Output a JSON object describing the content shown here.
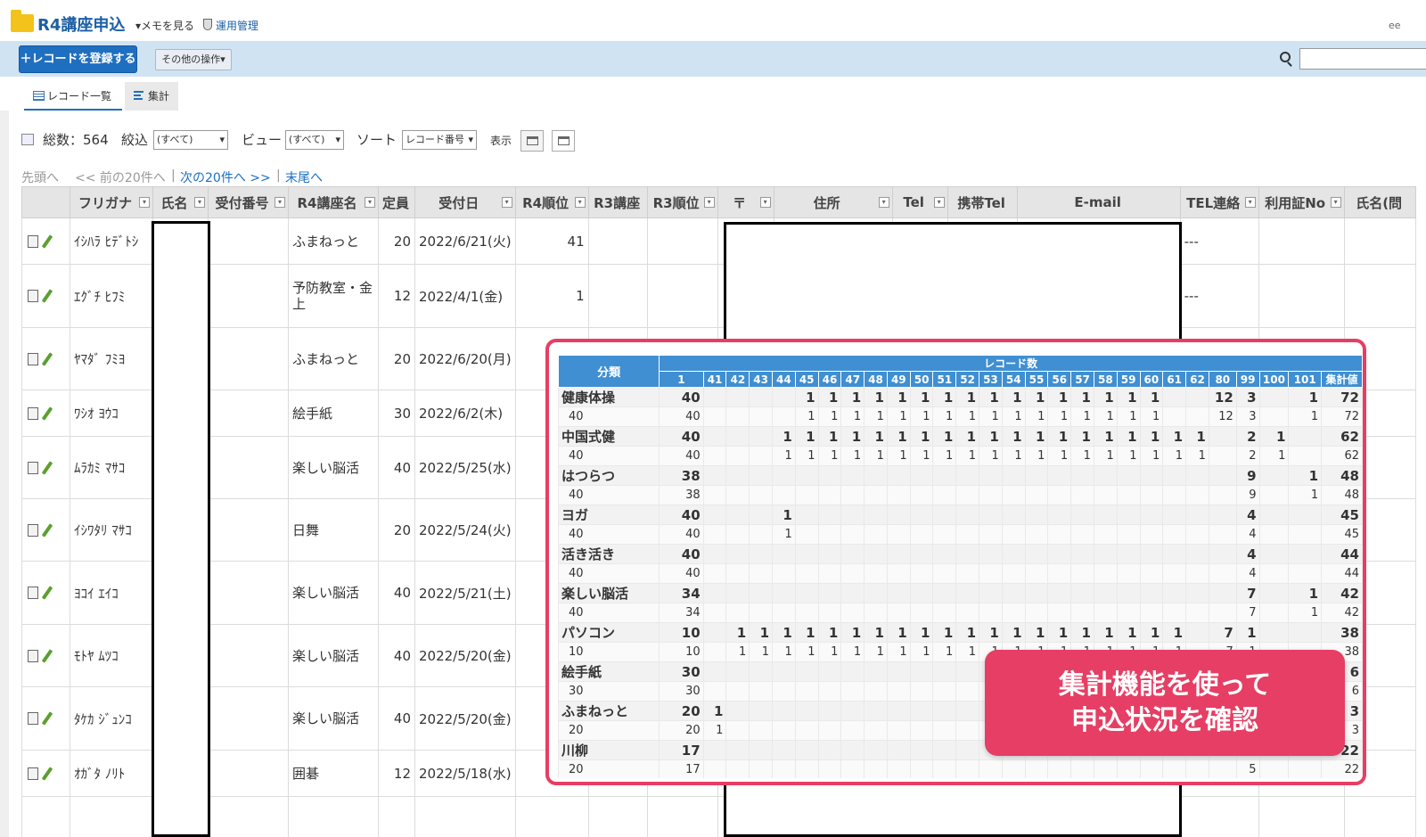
{
  "header": {
    "title": "R4講座申込",
    "memo": "▾メモを見る",
    "admin": "運用管理",
    "right_text": "ee"
  },
  "toolbar": {
    "add_label": "レコードを登録する",
    "other_label": "その他の操作▾"
  },
  "tabs": [
    {
      "label": "レコード一覧"
    },
    {
      "label": "集計"
    }
  ],
  "stats": {
    "total_label": "総数：564",
    "filter_label": "絞込",
    "filter_value": "(すべて)",
    "view_label": "ビュー",
    "view_value": "(すべて)",
    "sort_label": "ソート",
    "sort_value": "レコード番号",
    "display_label": "表示"
  },
  "pager": {
    "first": "先頭へ",
    "prev": "<< 前の20件へ",
    "sep1": "|",
    "next": "次の20件へ >>",
    "sep2": "|",
    "last": "末尾へ"
  },
  "table": {
    "columns": [
      "",
      "フリガナ",
      "氏名",
      "受付番号",
      "R4講座名",
      "定員",
      "受付日",
      "R4順位",
      "R3講座",
      "R3順位",
      "〒",
      "住所",
      "Tel",
      "携帯Tel",
      "E-mail",
      "TEL連絡",
      "利用証No",
      "氏名(問"
    ],
    "rows": [
      {
        "kana": "ｲｼﾊﾗ ﾋﾃﾞﾄｼ",
        "course": "ふまねっと",
        "cap": "20",
        "date": "2022/6/21(火)",
        "rank": "41",
        "tel": "---"
      },
      {
        "kana": "ｴｸﾞﾁ ﾋﾌﾐ",
        "course": "予防教室・金上",
        "cap": "12",
        "date": "2022/4/1(金)",
        "rank": "1",
        "tel": "---"
      },
      {
        "kana": "ﾔﾏﾀﾞ ﾌﾐﾖ",
        "course": "ふまねっと",
        "cap": "20",
        "date": "2022/6/20(月)",
        "rank": "",
        "tel": ""
      },
      {
        "kana": "ﾜｼｵ ﾖｳｺ",
        "course": "絵手紙",
        "cap": "30",
        "date": "2022/6/2(木)",
        "rank": "",
        "tel": ""
      },
      {
        "kana": "ﾑﾗｶﾐ ﾏｻｺ",
        "course": "楽しい脳活",
        "cap": "40",
        "date": "2022/5/25(水)",
        "rank": "",
        "tel": ""
      },
      {
        "kana": "ｲｼﾜﾀﾘ ﾏｻｺ",
        "course": "日舞",
        "cap": "20",
        "date": "2022/5/24(火)",
        "rank": "",
        "tel": ""
      },
      {
        "kana": "ﾖｺｲ ｴｲｺ",
        "course": "楽しい脳活",
        "cap": "40",
        "date": "2022/5/21(土)",
        "rank": "",
        "tel": ""
      },
      {
        "kana": "ﾓﾄﾔ ﾑﾂｺ",
        "course": "楽しい脳活",
        "cap": "40",
        "date": "2022/5/20(金)",
        "rank": "",
        "tel": ""
      },
      {
        "kana": "ﾀｹｶ ｼﾞｭﾝｺ",
        "course": "楽しい脳活",
        "cap": "40",
        "date": "2022/5/20(金)",
        "rank": "",
        "tel": ""
      },
      {
        "kana": "ｵｶﾞﾀ ﾉﾘﾄ",
        "course": "囲碁",
        "cap": "12",
        "date": "2022/5/18(水)",
        "rank": "",
        "tel": ""
      }
    ]
  },
  "agg": {
    "corner": "分類",
    "group": "レコード数",
    "cols": [
      "1",
      "41",
      "42",
      "43",
      "44",
      "45",
      "46",
      "47",
      "48",
      "49",
      "50",
      "51",
      "52",
      "53",
      "54",
      "55",
      "56",
      "57",
      "58",
      "59",
      "60",
      "61",
      "62",
      "80",
      "99",
      "100",
      "101",
      "集計値"
    ],
    "rows": [
      {
        "name": "健康体操",
        "sub": "40",
        "vals": [
          "40",
          "",
          "",
          "",
          "",
          "1",
          "1",
          "1",
          "1",
          "1",
          "1",
          "1",
          "1",
          "1",
          "1",
          "1",
          "1",
          "1",
          "1",
          "1",
          "1",
          "",
          "",
          "12",
          "3",
          "",
          "1",
          "72"
        ]
      },
      {
        "name": "中国式健",
        "sub": "40",
        "vals": [
          "40",
          "",
          "",
          "",
          "1",
          "1",
          "1",
          "1",
          "1",
          "1",
          "1",
          "1",
          "1",
          "1",
          "1",
          "1",
          "1",
          "1",
          "1",
          "1",
          "1",
          "1",
          "1",
          "",
          "2",
          "1",
          "",
          "62"
        ]
      },
      {
        "name": "はつらつ",
        "sub": "40",
        "vals": [
          "38",
          "",
          "",
          "",
          "",
          "",
          "",
          "",
          "",
          "",
          "",
          "",
          "",
          "",
          "",
          "",
          "",
          "",
          "",
          "",
          "",
          "",
          "",
          "",
          "9",
          "",
          "1",
          "48"
        ]
      },
      {
        "name": "ヨガ",
        "sub": "40",
        "vals": [
          "40",
          "",
          "",
          "",
          "1",
          "",
          "",
          "",
          "",
          "",
          "",
          "",
          "",
          "",
          "",
          "",
          "",
          "",
          "",
          "",
          "",
          "",
          "",
          "",
          "4",
          "",
          "",
          "45"
        ]
      },
      {
        "name": "活き活き",
        "sub": "40",
        "vals": [
          "40",
          "",
          "",
          "",
          "",
          "",
          "",
          "",
          "",
          "",
          "",
          "",
          "",
          "",
          "",
          "",
          "",
          "",
          "",
          "",
          "",
          "",
          "",
          "",
          "4",
          "",
          "",
          "44"
        ]
      },
      {
        "name": "楽しい脳活",
        "sub": "40",
        "vals": [
          "34",
          "",
          "",
          "",
          "",
          "",
          "",
          "",
          "",
          "",
          "",
          "",
          "",
          "",
          "",
          "",
          "",
          "",
          "",
          "",
          "",
          "",
          "",
          "",
          "7",
          "",
          "1",
          "42"
        ]
      },
      {
        "name": "パソコン",
        "sub": "10",
        "vals": [
          "10",
          "",
          "1",
          "1",
          "1",
          "1",
          "1",
          "1",
          "1",
          "1",
          "1",
          "1",
          "1",
          "1",
          "1",
          "1",
          "1",
          "1",
          "1",
          "1",
          "1",
          "1",
          "",
          "7",
          "1",
          "",
          "",
          "38"
        ]
      },
      {
        "name": "絵手紙",
        "sub": "30",
        "vals": [
          "30",
          "",
          "",
          "",
          "",
          "",
          "",
          "",
          "",
          "",
          "",
          "",
          "",
          "",
          "",
          "",
          "",
          "",
          "",
          "",
          "",
          "",
          "",
          "",
          "",
          "",
          "",
          "6"
        ]
      },
      {
        "name": "ふまねっと",
        "sub": "20",
        "vals": [
          "20",
          "1",
          "",
          "",
          "",
          "",
          "",
          "",
          "",
          "",
          "",
          "",
          "",
          "",
          "",
          "",
          "",
          "",
          "",
          "",
          "",
          "",
          "",
          "",
          "",
          "",
          "",
          "3"
        ]
      },
      {
        "name": "川柳",
        "sub": "20",
        "vals": [
          "17",
          "",
          "",
          "",
          "",
          "",
          "",
          "",
          "",
          "",
          "",
          "",
          "",
          "",
          "",
          "",
          "",
          "",
          "",
          "",
          "",
          "",
          "",
          "",
          "5",
          "",
          "",
          "22"
        ]
      }
    ]
  },
  "callout": {
    "line1": "集計機能を使って",
    "line2": "申込状況を確認"
  },
  "colors": {
    "accent": "#1f6fc0",
    "callout": "#e63e64",
    "agg_header": "#3f8fd2"
  }
}
